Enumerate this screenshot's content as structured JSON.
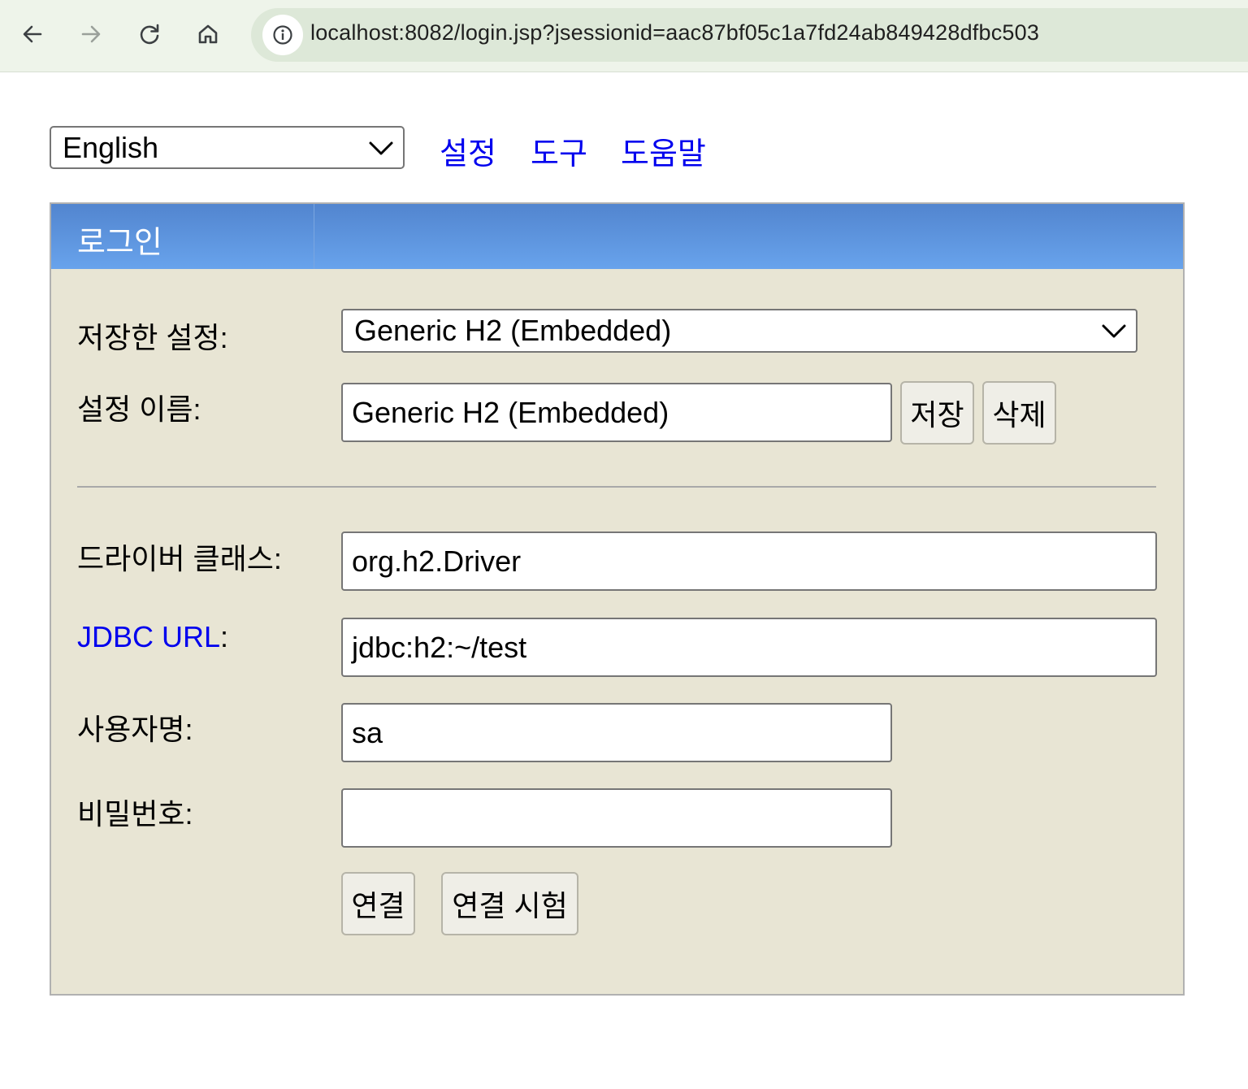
{
  "browser": {
    "url": "localhost:8082/login.jsp?jsessionid=aac87bf05c1a7fd24ab849428dfbc503",
    "icons": [
      "back-arrow-icon",
      "forward-arrow-icon",
      "reload-icon",
      "home-icon",
      "site-info-icon"
    ]
  },
  "top": {
    "language": "English",
    "links": [
      "설정",
      "도구",
      "도움말"
    ]
  },
  "login": {
    "title": "로그인",
    "saved_settings_label": "저장한 설정:",
    "saved_settings_value": "Generic H2 (Embedded)",
    "setting_name_label": "설정 이름:",
    "setting_name_value": "Generic H2 (Embedded)",
    "save_button": "저장",
    "delete_button": "삭제",
    "driver_class_label": "드라이버 클래스:",
    "driver_class_value": "org.h2.Driver",
    "jdbc_url_label": "JDBC URL",
    "jdbc_url_colon": ":",
    "jdbc_url_value": "jdbc:h2:~/test",
    "username_label": "사용자명:",
    "username_value": "sa",
    "password_label": "비밀번호:",
    "password_value": "",
    "connect_button": "연결",
    "test_connection_button": "연결 시험"
  },
  "colors": {
    "header_gradient_top": "#5285cf",
    "header_gradient_bottom": "#68a3ec",
    "panel_background": "#e8e5d4",
    "link": "#0000ee"
  }
}
